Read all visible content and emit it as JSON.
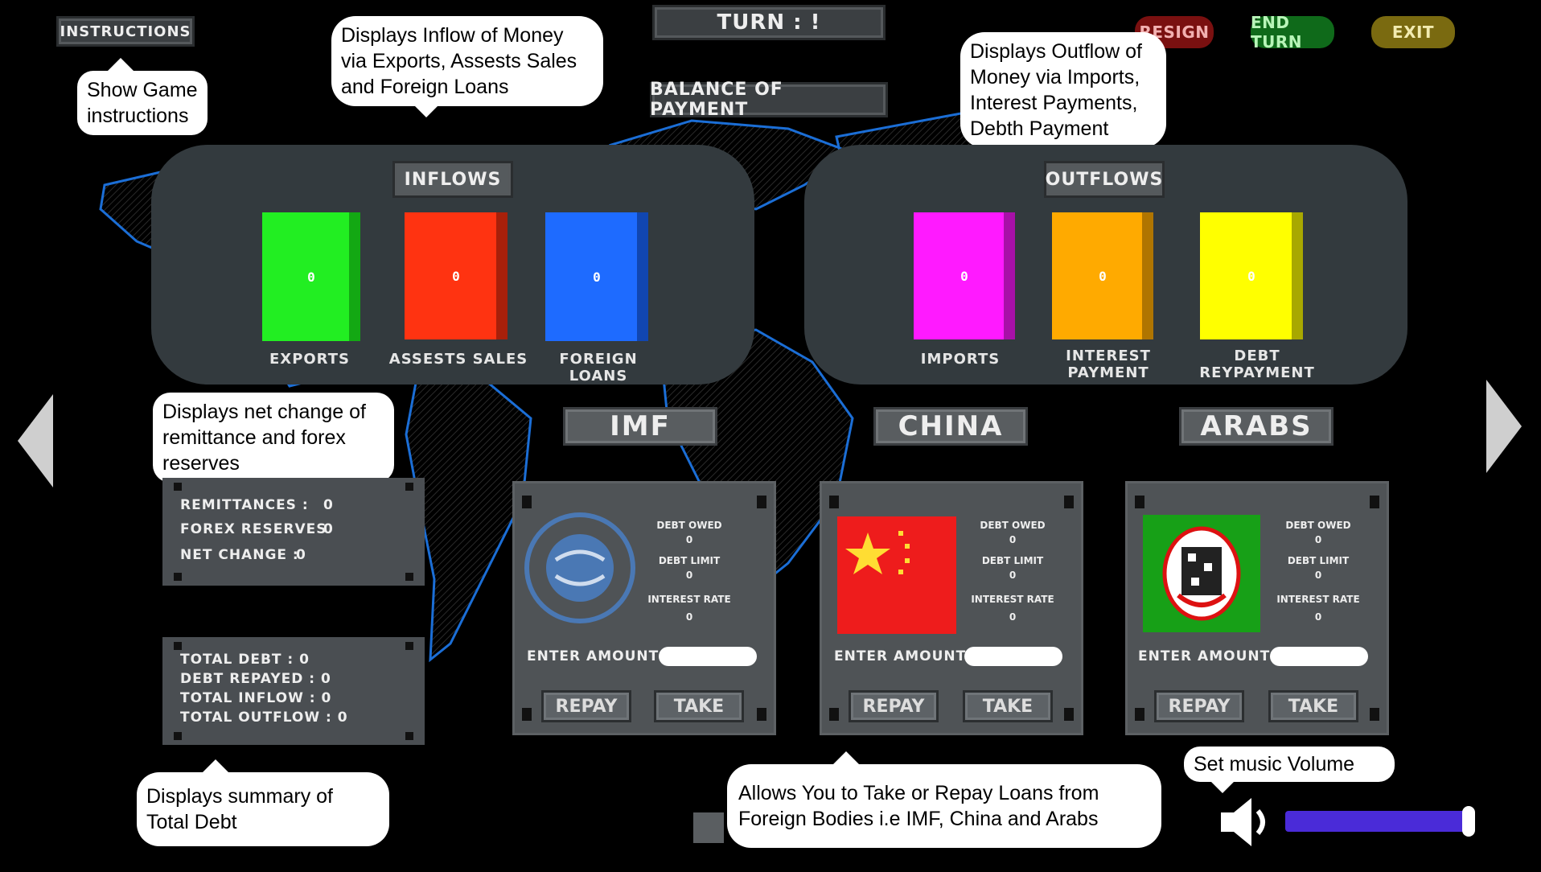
{
  "top": {
    "instructions_label": "INSTRUCTIONS",
    "turn_label": "TURN : !",
    "bop_label": "BALANCE OF PAYMENT",
    "resign_label": "RESIGN",
    "end_turn_label": "END TURN",
    "exit_label": "EXIT"
  },
  "tooltips": {
    "instructions": "Show Game instructions",
    "inflows": "Displays Inflow of Money via Exports, Assests Sales and Foreign Loans",
    "outflows": "Displays Outflow of Money via Imports, Interest Payments, Debth Payment",
    "net_change": "Displays net change of remittance and forex reserves",
    "summary": "Displays summary of Total Debt",
    "lenders": "Allows You to Take or Repay Loans from Foreign Bodies i.e IMF, China and Arabs",
    "music": "Set music Volume"
  },
  "inflows": {
    "title": "INFLOWS",
    "items": [
      {
        "label": "EXPORTS",
        "value": "0",
        "color": "#22ee22"
      },
      {
        "label": "ASSESTS SALES",
        "value": "0",
        "color": "#ff3311"
      },
      {
        "label": "FOREIGN LOANS",
        "value": "0",
        "color": "#1e6bff"
      }
    ]
  },
  "outflows": {
    "title": "OUTFLOWS",
    "items": [
      {
        "label": "IMPORTS",
        "value": "0",
        "color": "#ff1aff"
      },
      {
        "label": "INTEREST PAYMENT",
        "value": "0",
        "color": "#ffaa00"
      },
      {
        "label": "DEBT REYPAYMENT",
        "value": "0",
        "color": "#ffff00"
      }
    ]
  },
  "reserves": {
    "remittances_label": "REMITTANCES :",
    "remittances_value": "0",
    "forex_label": "FOREX RESERVES",
    "forex_value": "0",
    "net_label": "NET CHANGE :",
    "net_value": "0"
  },
  "summary": {
    "total_debt": "TOTAL DEBT : 0",
    "debt_repayed": "DEBT REPAYED : 0",
    "total_inflow": "TOTAL INFLOW : 0",
    "total_outflow": "TOTAL OUTFLOW : 0"
  },
  "lenders": [
    {
      "name": "IMF",
      "debt_owed_label": "DEBT OWED",
      "debt_owed": "0",
      "debt_limit_label": "DEBT LIMIT",
      "debt_limit": "0",
      "interest_label": "INTEREST RATE",
      "interest": "0",
      "enter_amount": "ENTER AMOUNT :",
      "repay": "REPAY",
      "take": "TAKE",
      "logo_text": "INTERNATIONAL MONETARY FUND"
    },
    {
      "name": "CHINA",
      "debt_owed_label": "DEBT OWED",
      "debt_owed": "0",
      "debt_limit_label": "DEBT LIMIT",
      "debt_limit": "0",
      "interest_label": "INTEREST RATE",
      "interest": "0",
      "enter_amount": "ENTER AMOUNT :",
      "repay": "REPAY",
      "take": "TAKE"
    },
    {
      "name": "ARABS",
      "debt_owed_label": "DEBT OWED",
      "debt_owed": "0",
      "debt_limit_label": "DEBT LIMIT",
      "debt_limit": "0",
      "interest_label": "INTEREST RATE",
      "interest": "0",
      "enter_amount": "ENTER AMOUNT :",
      "repay": "REPAY",
      "take": "TAKE"
    }
  ],
  "volume": {
    "level": 0.95
  },
  "colors": {
    "resign": "#7a1010",
    "end_turn": "#0f6a1a",
    "exit": "#7a6a10",
    "map_outline": "#1b6ed6",
    "volume_bar": "#4a2bd8"
  }
}
